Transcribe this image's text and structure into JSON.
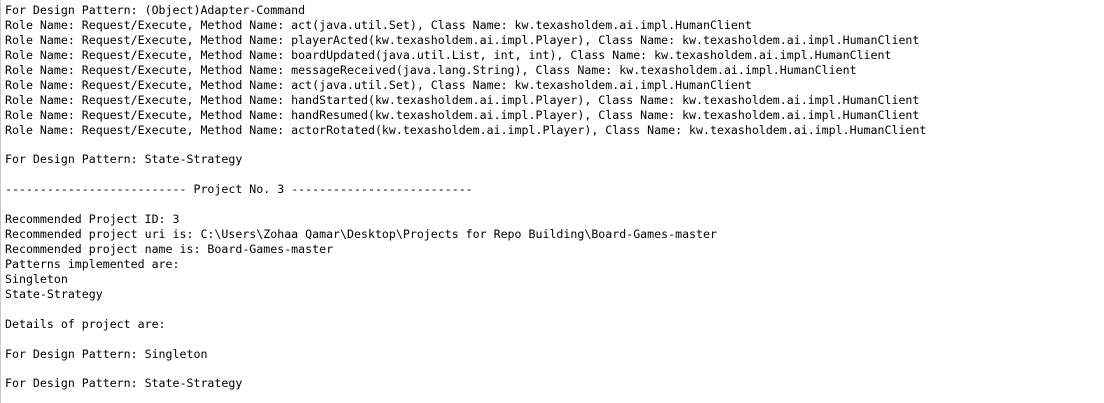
{
  "console": {
    "lines": [
      "For Design Pattern: (Object)Adapter-Command",
      "Role Name: Request/Execute, Method Name: act(java.util.Set), Class Name: kw.texasholdem.ai.impl.HumanClient",
      "Role Name: Request/Execute, Method Name: playerActed(kw.texasholdem.ai.impl.Player), Class Name: kw.texasholdem.ai.impl.HumanClient",
      "Role Name: Request/Execute, Method Name: boardUpdated(java.util.List, int, int), Class Name: kw.texasholdem.ai.impl.HumanClient",
      "Role Name: Request/Execute, Method Name: messageReceived(java.lang.String), Class Name: kw.texasholdem.ai.impl.HumanClient",
      "Role Name: Request/Execute, Method Name: act(java.util.Set), Class Name: kw.texasholdem.ai.impl.HumanClient",
      "Role Name: Request/Execute, Method Name: handStarted(kw.texasholdem.ai.impl.Player), Class Name: kw.texasholdem.ai.impl.HumanClient",
      "Role Name: Request/Execute, Method Name: handResumed(kw.texasholdem.ai.impl.Player), Class Name: kw.texasholdem.ai.impl.HumanClient",
      "Role Name: Request/Execute, Method Name: actorRotated(kw.texasholdem.ai.impl.Player), Class Name: kw.texasholdem.ai.impl.HumanClient",
      "",
      "For Design Pattern: State-Strategy",
      "",
      "-------------------------- Project No. 3 --------------------------",
      "",
      "Recommended Project ID: 3",
      "Recommended project uri is: C:\\Users\\Zohaa Qamar\\Desktop\\Projects for Repo Building\\Board-Games-master",
      "Recommended project name is: Board-Games-master",
      "Patterns implemented are:",
      "Singleton",
      "State-Strategy",
      "",
      "Details of project are:",
      "",
      "For Design Pattern: Singleton",
      "",
      "For Design Pattern: State-Strategy"
    ]
  }
}
